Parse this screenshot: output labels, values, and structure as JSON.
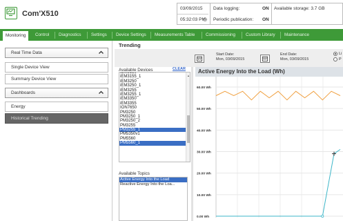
{
  "header": {
    "app_title": "Com'X510",
    "date": "03/09/2015",
    "time": "05:32:03 PM",
    "data_logging_label": "Data logging:",
    "data_logging_value": "ON",
    "periodic_label": "Periodic publication:",
    "periodic_value": "ON",
    "storage_label": "Available storage: 3.7 GB"
  },
  "nav": {
    "tabs": [
      "Monitoring",
      "Control",
      "Diagnostics",
      "Settings",
      "Device Settings",
      "Measurements Table",
      "Commissioning",
      "Custom Library",
      "Maintenance"
    ]
  },
  "sidebar": {
    "real_time": "Real Time Data",
    "single_device": "Single Device View",
    "summary_device": "Summary Device View",
    "dashboards": "Dashboards",
    "energy": "Energy",
    "historical": "Historical Trending"
  },
  "trending": {
    "title": "Trending",
    "start_label": "Start Date:",
    "start_value": "Mon, 03/09/2015",
    "end_label": "End Date:",
    "end_value": "Mon, 03/09/2015",
    "radio1": "Li",
    "radio2": "P",
    "available_devices": "Available Devices",
    "clear": "CLEAR",
    "devices": [
      "iEM3150",
      "iEM3155_1",
      "iEM3250",
      "iEM3250_1",
      "iEM3255",
      "iEM3255_1",
      "iEM3350",
      "iEM3355",
      "ION7650",
      "PM3250",
      "PM3250_1",
      "PM3250_2",
      "PM3255",
      "PM3255_1",
      "PM5350v1",
      "PM5560",
      "PM5560_1"
    ],
    "selected_devices": [
      "PM3255_1",
      "PM5560_1"
    ],
    "available_topics": "Available Topics",
    "topics": [
      "Active Energy Into the Load",
      "Reactive Energy Into the Loa..."
    ],
    "selected_topic": "Active Energy Into the Load"
  },
  "chart_data": {
    "type": "line",
    "title": "Active Energy Into the Load (Wh)",
    "ylim": [
      0,
      60
    ],
    "y_ticks": [
      "0.00 Wh",
      "10.00 Wh",
      "20.00 Wh",
      "30.00 Wh",
      "40.00 Wh",
      "50.00 Wh",
      "60.00 Wh"
    ],
    "y_tick_values": [
      0,
      10,
      20,
      30,
      40,
      50,
      60
    ],
    "grid": true,
    "series": [
      {
        "color": "#f0a040",
        "x": [
          0,
          1,
          2,
          3,
          4,
          5,
          6,
          7,
          8,
          9,
          10,
          11,
          12,
          13,
          14
        ],
        "values": [
          56,
          58,
          56,
          58,
          54,
          58,
          55,
          58,
          54,
          58,
          55,
          58,
          54,
          58,
          56
        ]
      },
      {
        "color": "#3cb6c8",
        "x": [
          0,
          10,
          12,
          13.3,
          14
        ],
        "values": [
          0,
          0,
          0,
          29,
          31
        ]
      }
    ],
    "xlim": [
      0,
      14
    ]
  }
}
